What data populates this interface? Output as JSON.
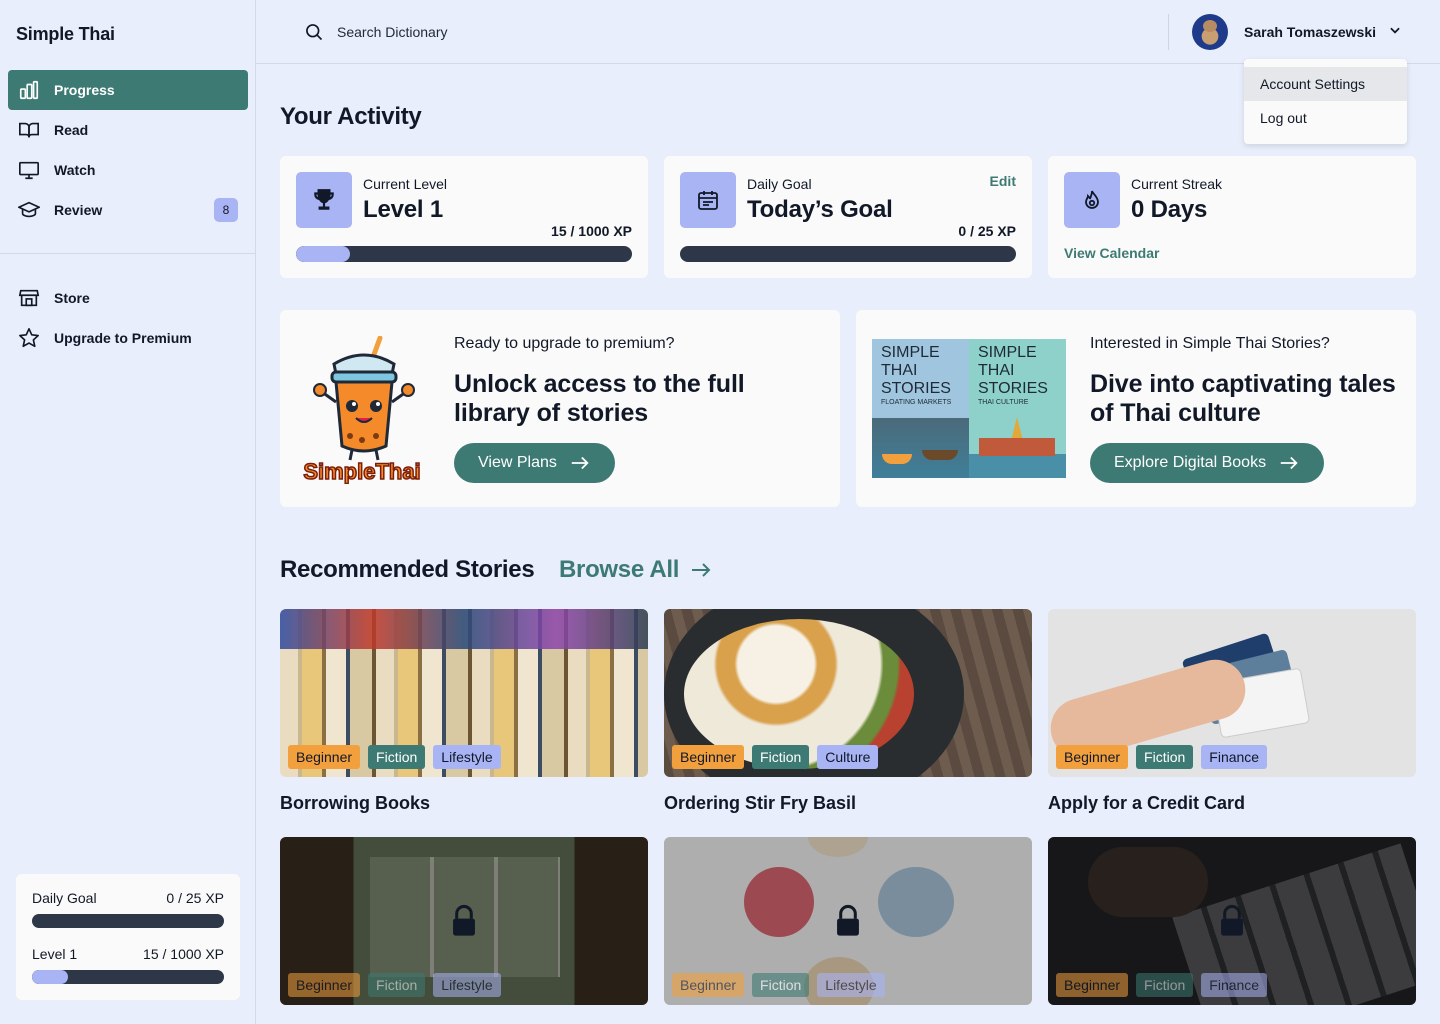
{
  "app": {
    "brand": "Simple Thai"
  },
  "sidebar": {
    "items": [
      {
        "label": "Progress",
        "icon": "chart-bar-icon",
        "active": true
      },
      {
        "label": "Read",
        "icon": "book-open-icon"
      },
      {
        "label": "Watch",
        "icon": "monitor-icon"
      },
      {
        "label": "Review",
        "icon": "graduation-cap-icon",
        "badge": "8"
      }
    ],
    "secondary": [
      {
        "label": "Store",
        "icon": "storefront-icon"
      },
      {
        "label": "Upgrade to Premium",
        "icon": "star-icon"
      }
    ],
    "summary": {
      "daily_goal_label": "Daily Goal",
      "daily_goal_value": "0 / 25 XP",
      "daily_goal_progress": 0,
      "level_label": "Level 1",
      "level_value": "15 / 1000 XP",
      "level_progress": 0.015
    }
  },
  "topbar": {
    "search_placeholder": "Search Dictionary",
    "user_name": "Sarah Tomaszewski",
    "menu": [
      "Account Settings",
      "Log out"
    ]
  },
  "activity": {
    "title": "Your Activity",
    "level": {
      "label": "Current Level",
      "value": "Level 1",
      "xp": "15 / 1000 XP",
      "progress": 0.015
    },
    "goal": {
      "label": "Daily Goal",
      "value": "Today’s Goal",
      "xp": "0 / 25 XP",
      "edit": "Edit",
      "progress": 0
    },
    "streak": {
      "label": "Current Streak",
      "value": "0 Days",
      "link": "View Calendar"
    }
  },
  "promos": {
    "premium": {
      "sub": "Ready to upgrade to premium?",
      "head": "Unlock access to the full library of stories",
      "button": "View Plans",
      "logo_text": "SimpleThai"
    },
    "books": {
      "sub": "Interested in Simple Thai Stories?",
      "head": "Dive into captivating tales of Thai culture",
      "button": "Explore Digital Books",
      "book1": {
        "title": "SIMPLE THAI STORIES",
        "subtitle": "FLOATING MARKETS"
      },
      "book2": {
        "title": "SIMPLE THAI STORIES",
        "subtitle": "THAI CULTURE"
      }
    }
  },
  "recommended": {
    "title": "Recommended Stories",
    "browse": "Browse All",
    "stories": [
      {
        "title": "Borrowing Books",
        "tags": [
          "Beginner",
          "Fiction",
          "Lifestyle"
        ],
        "locked": false
      },
      {
        "title": "Ordering Stir Fry Basil",
        "tags": [
          "Beginner",
          "Fiction",
          "Culture"
        ],
        "locked": false
      },
      {
        "title": "Apply for a Credit Card",
        "tags": [
          "Beginner",
          "Fiction",
          "Finance"
        ],
        "locked": false
      },
      {
        "title": "",
        "tags": [
          "Beginner",
          "Fiction",
          "Lifestyle"
        ],
        "locked": true
      },
      {
        "title": "",
        "tags": [
          "Beginner",
          "Fiction",
          "Lifestyle"
        ],
        "locked": true
      },
      {
        "title": "",
        "tags": [
          "Beginner",
          "Fiction",
          "Finance"
        ],
        "locked": true
      }
    ]
  },
  "colors": {
    "accent": "#3d7a73",
    "lavender": "#a9b4f4",
    "orange": "#f2a03e",
    "background": "#e8eefb",
    "dark": "#2d3748"
  }
}
